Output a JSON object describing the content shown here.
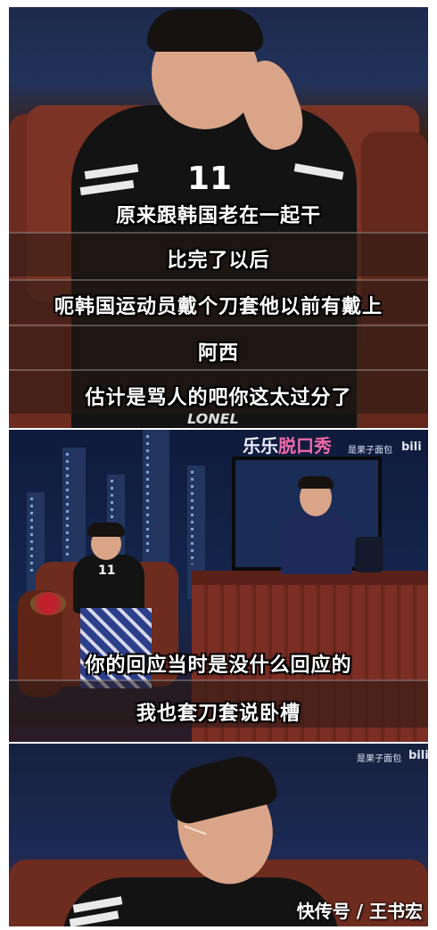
{
  "panel1": {
    "subtitles": [
      "原来跟韩国老在一起干",
      "比完了以后",
      "呃韩国运动员戴个刀套他以前有戴上",
      "阿西",
      "估计是骂人的吧你这太过分了"
    ],
    "shirt_text": "11",
    "shirt_print": "LONEL"
  },
  "panel2": {
    "show_brand_left": "乐乐",
    "show_brand_right": "脱口秀",
    "sponsor": "是果子面包",
    "site_logo": "bili",
    "shirt_text": "11",
    "subtitles": [
      "你的回应当时是没什么回应的",
      "我也套刀套说卧槽"
    ]
  },
  "panel3": {
    "sponsor": "是果子面包",
    "site_logo": "bili",
    "watermark": "快传号 / 王书宏"
  },
  "colors": {
    "sofa": "#6e2c1f",
    "studio_blue": "#15264e",
    "subtitle_text": "#ffffff",
    "brand_pink": "#f06aa8"
  }
}
